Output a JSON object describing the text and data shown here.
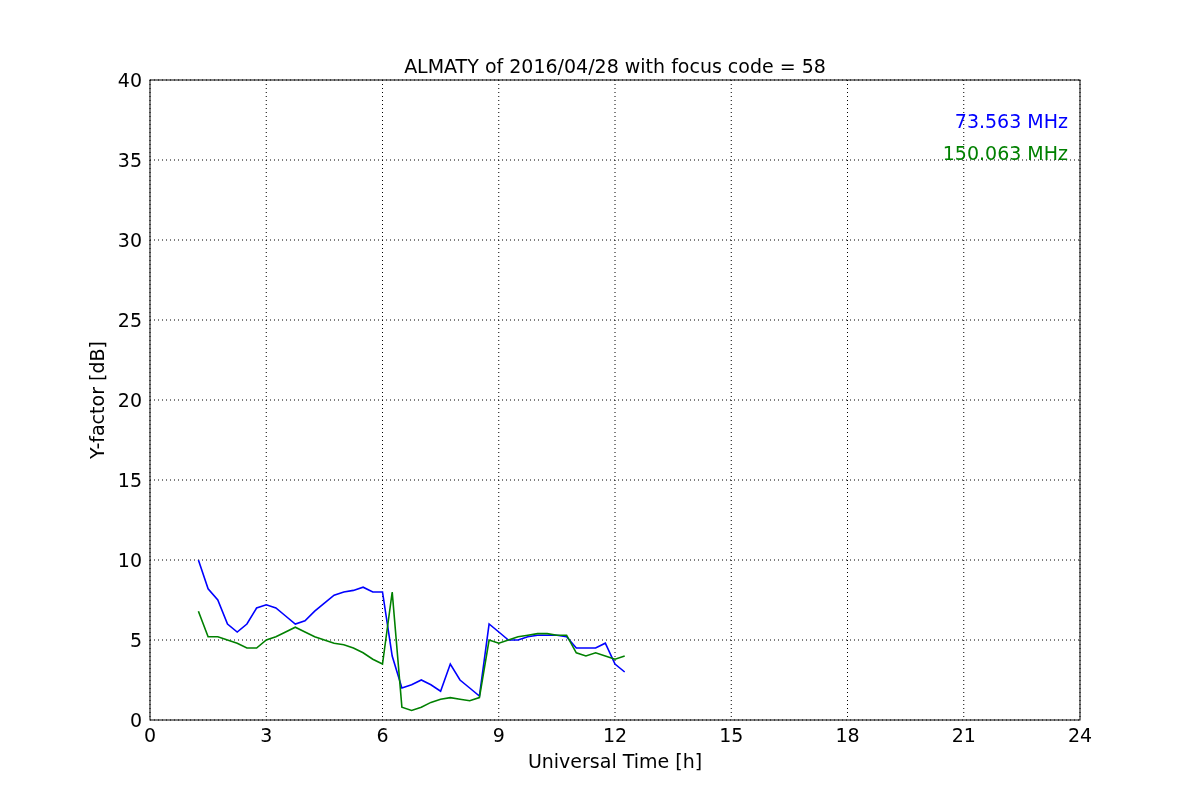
{
  "chart_data": {
    "type": "line",
    "title": "ALMATY of 2016/04/28 with focus code = 58",
    "xlabel": "Universal Time [h]",
    "ylabel": "Y-factor [dB]",
    "x": [
      1.25,
      1.5,
      1.75,
      2.0,
      2.25,
      2.5,
      2.75,
      3.0,
      3.25,
      3.5,
      3.75,
      4.0,
      4.25,
      4.5,
      4.75,
      5.0,
      5.25,
      5.5,
      5.75,
      6.0,
      6.25,
      6.5,
      6.75,
      7.0,
      7.25,
      7.5,
      7.75,
      8.0,
      8.25,
      8.5,
      8.75,
      9.0,
      9.25,
      9.5,
      9.75,
      10.0,
      10.25,
      10.5,
      10.75,
      11.0,
      11.25,
      11.5,
      11.75,
      12.0,
      12.25
    ],
    "series": [
      {
        "name": "73.563 MHz",
        "color": "#0000ff",
        "values": [
          10,
          8.2,
          7.5,
          6,
          5.5,
          6,
          7,
          7.2,
          7,
          6.5,
          6,
          6.2,
          6.8,
          7.3,
          7.8,
          8,
          8.1,
          8.3,
          8,
          8,
          4,
          2,
          2.2,
          2.5,
          2.2,
          1.8,
          3.5,
          2.5,
          2,
          1.5,
          6,
          5.5,
          5,
          5,
          5.2,
          5.3,
          5.3,
          5.3,
          5.2,
          4.5,
          4.5,
          4.5,
          4.8,
          3.5,
          3
        ]
      },
      {
        "name": "150.063 MHz",
        "color": "#008000",
        "values": [
          6.8,
          5.2,
          5.2,
          5,
          4.8,
          4.5,
          4.5,
          5,
          5.2,
          5.5,
          5.8,
          5.5,
          5.2,
          5,
          4.8,
          4.7,
          4.5,
          4.2,
          3.8,
          3.5,
          8,
          0.8,
          0.6,
          0.8,
          1.1,
          1.3,
          1.4,
          1.3,
          1.2,
          1.4,
          5,
          4.8,
          5,
          5.2,
          5.3,
          5.4,
          5.4,
          5.3,
          5.3,
          4.2,
          4,
          4.2,
          4,
          3.8,
          4
        ]
      }
    ],
    "grid": true,
    "xlim": [
      0,
      24
    ],
    "ylim": [
      0,
      40
    ],
    "xticks": [
      0,
      3,
      6,
      9,
      12,
      15,
      18,
      21,
      24
    ],
    "yticks": [
      0,
      5,
      10,
      15,
      20,
      25,
      30,
      35,
      40
    ]
  }
}
